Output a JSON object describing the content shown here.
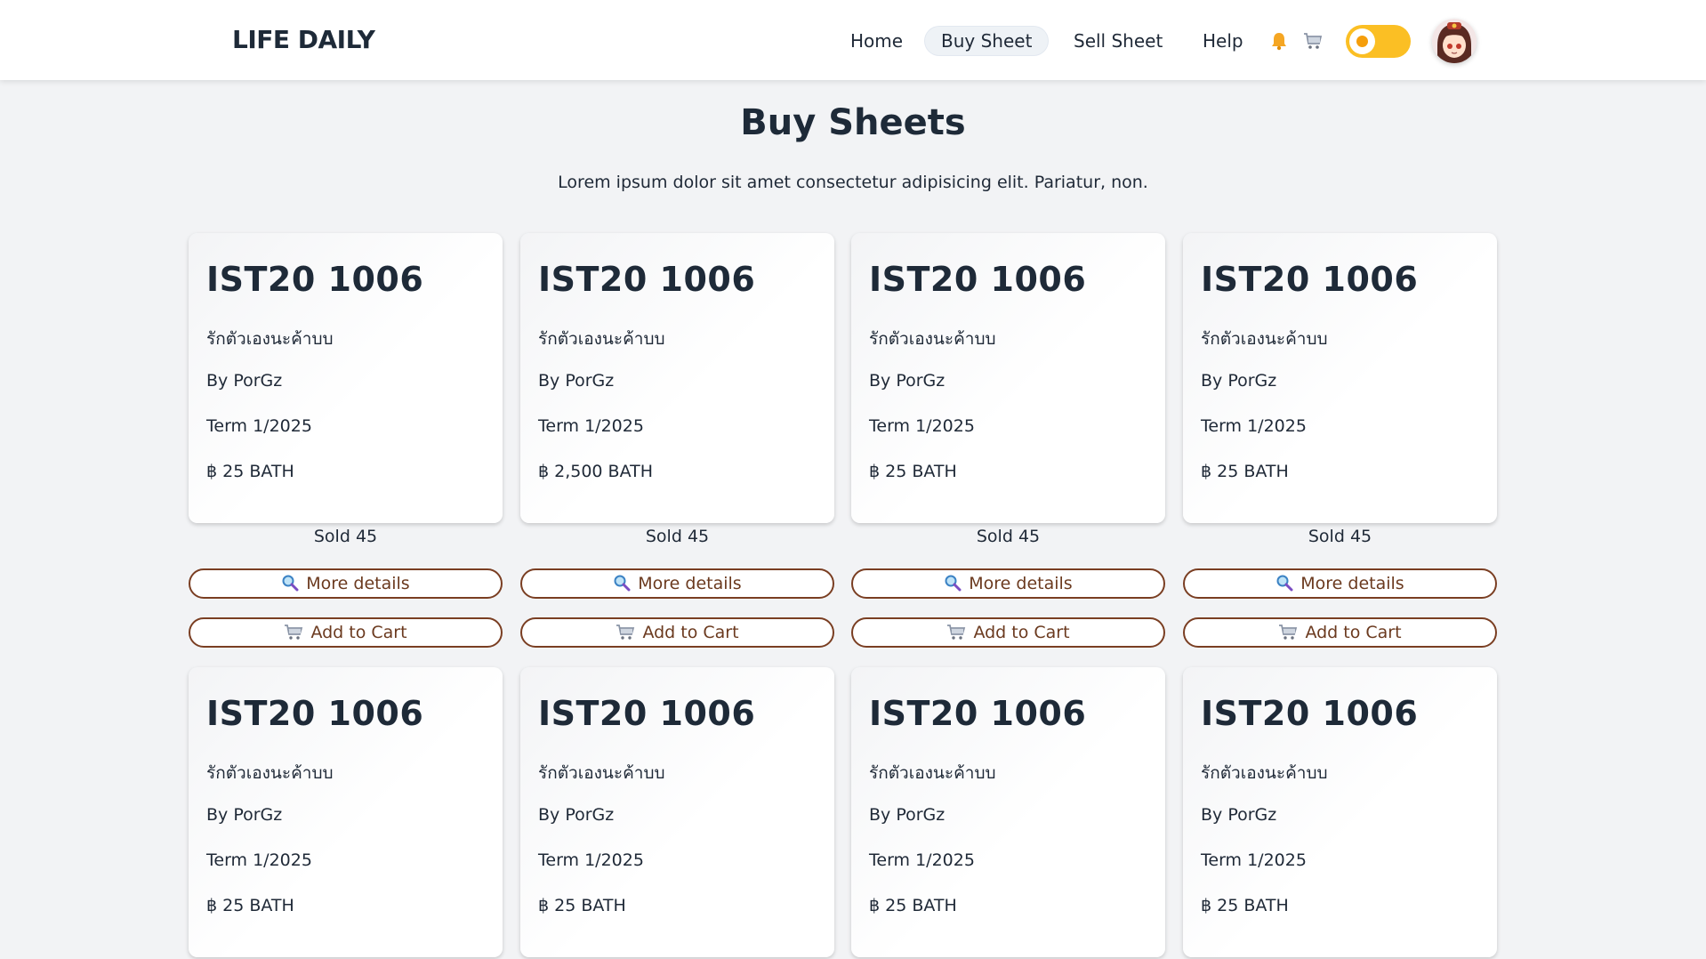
{
  "brand": "LIFE DAILY",
  "nav": {
    "links": [
      {
        "label": "Home",
        "active": false
      },
      {
        "label": "Buy Sheet",
        "active": true
      },
      {
        "label": "Sell Sheet",
        "active": false
      },
      {
        "label": "Help",
        "active": false
      }
    ],
    "icons": [
      "bell-icon",
      "cart-icon"
    ],
    "theme_toggle": {
      "on": true
    }
  },
  "page": {
    "title": "Buy Sheets",
    "subtitle": "Lorem ipsum dolor sit amet consectetur adipisicing elit. Pariatur, non."
  },
  "cards": [
    {
      "code": "IST20 1006",
      "name": "รักตัวเองนะค้าบบ",
      "author": "By PorGz",
      "term": "Term 1/2025",
      "price": "฿ 25 BATH",
      "sold": "Sold 45",
      "details_label": "More details",
      "cart_label": "Add to Cart"
    },
    {
      "code": "IST20 1006",
      "name": "รักตัวเองนะค้าบบ",
      "author": "By PorGz",
      "term": "Term 1/2025",
      "price": "฿ 2,500 BATH",
      "sold": "Sold 45",
      "details_label": "More details",
      "cart_label": "Add to Cart"
    },
    {
      "code": "IST20 1006",
      "name": "รักตัวเองนะค้าบบ",
      "author": "By PorGz",
      "term": "Term 1/2025",
      "price": "฿ 25 BATH",
      "sold": "Sold 45",
      "details_label": "More details",
      "cart_label": "Add to Cart"
    },
    {
      "code": "IST20 1006",
      "name": "รักตัวเองนะค้าบบ",
      "author": "By PorGz",
      "term": "Term 1/2025",
      "price": "฿ 25 BATH",
      "sold": "Sold 45",
      "details_label": "More details",
      "cart_label": "Add to Cart"
    },
    {
      "code": "IST20 1006",
      "name": "รักตัวเองนะค้าบบ",
      "author": "By PorGz",
      "term": "Term 1/2025",
      "price": "฿ 25 BATH",
      "sold": "",
      "details_label": "",
      "cart_label": ""
    },
    {
      "code": "IST20 1006",
      "name": "รักตัวเองนะค้าบบ",
      "author": "By PorGz",
      "term": "Term 1/2025",
      "price": "฿ 25 BATH",
      "sold": "",
      "details_label": "",
      "cart_label": ""
    },
    {
      "code": "IST20 1006",
      "name": "รักตัวเองนะค้าบบ",
      "author": "By PorGz",
      "term": "Term 1/2025",
      "price": "฿ 25 BATH",
      "sold": "",
      "details_label": "",
      "cart_label": ""
    },
    {
      "code": "IST20 1006",
      "name": "รักตัวเองนะค้าบบ",
      "author": "By PorGz",
      "term": "Term 1/2025",
      "price": "฿ 25 BATH",
      "sold": "",
      "details_label": "",
      "cart_label": ""
    }
  ],
  "colors": {
    "accent": "#fbbf24",
    "button_border": "#7a3e22",
    "title": "#1e2a38"
  }
}
